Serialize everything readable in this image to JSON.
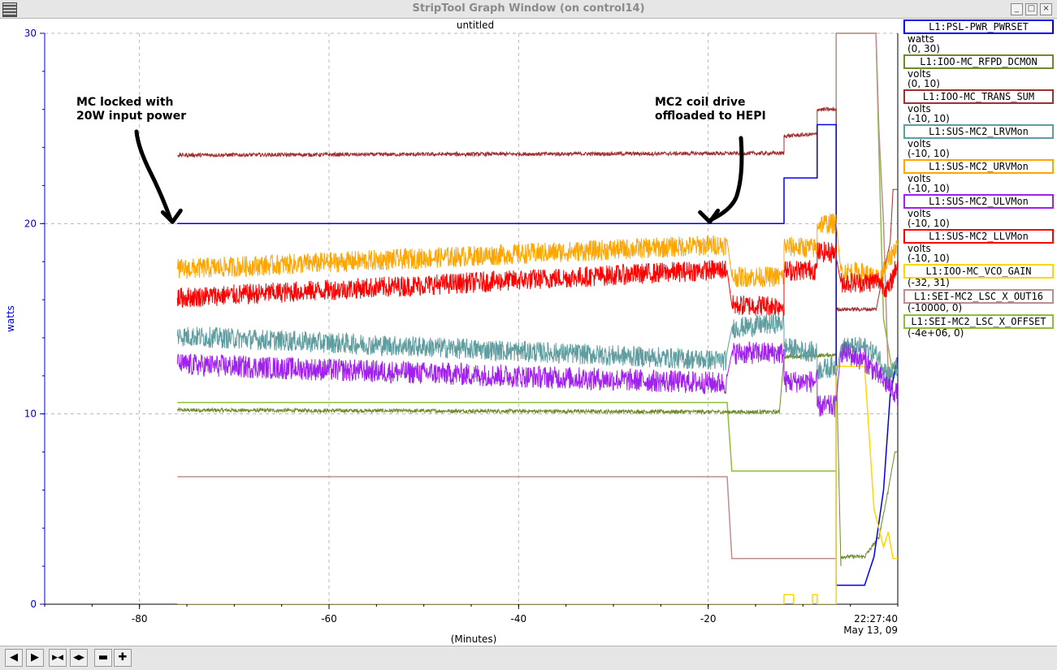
{
  "window": {
    "title": "StripTool Graph Window (on control14)",
    "menu_icon": "window-menu-icon",
    "min_icon": "minimize-icon",
    "max_icon": "maximize-icon",
    "close_icon": "close-icon"
  },
  "toolbar": {
    "buttons": [
      {
        "name": "scroll-left-icon",
        "glyph": "◀"
      },
      {
        "name": "scroll-right-icon",
        "glyph": "▶"
      },
      {
        "name": "zoom-in-time-icon",
        "glyph": "▶◀"
      },
      {
        "name": "zoom-out-time-icon",
        "glyph": "◀▶"
      },
      {
        "name": "pan-to-end-icon",
        "glyph": "▬"
      },
      {
        "name": "crosshair-icon",
        "glyph": "✚"
      }
    ]
  },
  "chart_data": {
    "type": "line",
    "title": "untitled",
    "ylabel": "watts",
    "xlabel": "(Minutes)",
    "xlim": [
      -90,
      0
    ],
    "ylim": [
      0,
      30
    ],
    "x_ticks": [
      -80,
      -60,
      -40,
      -20
    ],
    "y_ticks": [
      0,
      10,
      20,
      30
    ],
    "time_label": "22:27:40",
    "date_label": "May 13, 09",
    "grid": true,
    "legend_position": "right",
    "annotations": [
      {
        "text_line1": "MC locked with",
        "text_line2": "20W input power",
        "arrow_to": [
          -76,
          20
        ]
      },
      {
        "text_line1": "MC2 coil drive",
        "text_line2": "offloaded to HEPI",
        "arrow_to": [
          -20,
          20
        ]
      }
    ],
    "series": [
      {
        "name": "L1:PSL-PWR_PWRSET",
        "units": "watts",
        "range": "(0, 30)",
        "color": "#0000ee",
        "noise": 0,
        "points": [
          [
            -76,
            20
          ],
          [
            -12,
            20
          ],
          [
            -12,
            22.4
          ],
          [
            -8.5,
            22.4
          ],
          [
            -8.5,
            25.2
          ],
          [
            -6.5,
            25.2
          ],
          [
            -6.5,
            1.0
          ],
          [
            -3.5,
            1.0
          ],
          [
            -2.5,
            2.5
          ],
          [
            -1.5,
            6
          ],
          [
            -0.8,
            11
          ],
          [
            0,
            13
          ]
        ]
      },
      {
        "name": "L1:IOO-MC_RFPD_DCMON",
        "units": "volts",
        "range": "(0, 10)",
        "color": "#6e8b2a",
        "noise": 0.1,
        "points": [
          [
            -76,
            10.2
          ],
          [
            -12.5,
            10.1
          ],
          [
            -12,
            13
          ],
          [
            -6.5,
            13.1
          ],
          [
            -6,
            2
          ],
          [
            -6,
            2.5
          ],
          [
            -3.5,
            2.5
          ],
          [
            -2,
            3.5
          ],
          [
            -1,
            6
          ],
          [
            -0.3,
            8
          ],
          [
            0,
            8
          ]
        ]
      },
      {
        "name": "L1:IOO-MC_TRANS_SUM",
        "units": "volts",
        "range": "(-10, 10)",
        "color": "#a03030",
        "noise": 0.1,
        "points": [
          [
            -76,
            23.6
          ],
          [
            -12,
            23.7
          ],
          [
            -12,
            24.6
          ],
          [
            -8.5,
            24.7
          ],
          [
            -8.5,
            26.0
          ],
          [
            -6.5,
            26.0
          ],
          [
            -6.5,
            15.5
          ],
          [
            -2.3,
            15.5
          ],
          [
            -1.5,
            17.5
          ],
          [
            -0.8,
            19
          ],
          [
            -0.5,
            21.8
          ],
          [
            0,
            21.8
          ]
        ]
      },
      {
        "name": "L1:SUS-MC2_LRVMon",
        "units": "volts",
        "range": "(-10, 10)",
        "color": "#5f9ea0",
        "noise": 0.55,
        "points": [
          [
            -76,
            14.1
          ],
          [
            -18,
            12.8
          ],
          [
            -17.5,
            14.5
          ],
          [
            -12,
            14.8
          ],
          [
            -12,
            13.5
          ],
          [
            -8.5,
            13.2
          ],
          [
            -8.5,
            12.3
          ],
          [
            -6.5,
            12.5
          ],
          [
            -6,
            13.5
          ],
          [
            -3.5,
            13.5
          ],
          [
            -2,
            13
          ],
          [
            -1,
            12
          ],
          [
            0,
            12.5
          ]
        ]
      },
      {
        "name": "L1:SUS-MC2_URVMon",
        "units": "volts",
        "range": "(-10, 10)",
        "color": "#ffa500",
        "noise": 0.55,
        "points": [
          [
            -76,
            17.6
          ],
          [
            -18,
            18.9
          ],
          [
            -17.5,
            17.2
          ],
          [
            -12,
            17.2
          ],
          [
            -12,
            18.8
          ],
          [
            -8.5,
            18.7
          ],
          [
            -8.5,
            20.0
          ],
          [
            -6.5,
            20.0
          ],
          [
            -6,
            17.5
          ],
          [
            -3.5,
            17.4
          ],
          [
            -2,
            17
          ],
          [
            -1,
            18
          ],
          [
            0,
            19
          ]
        ]
      },
      {
        "name": "L1:SUS-MC2_ULVMon",
        "units": "volts",
        "range": "(-10, 10)",
        "color": "#a020f0",
        "noise": 0.6,
        "points": [
          [
            -76,
            12.6
          ],
          [
            -18,
            11.6
          ],
          [
            -17.5,
            13.2
          ],
          [
            -12,
            13.2
          ],
          [
            -12,
            11.7
          ],
          [
            -8.5,
            11.7
          ],
          [
            -8.5,
            10.4
          ],
          [
            -6.5,
            10.4
          ],
          [
            -6,
            13.3
          ],
          [
            -3.5,
            12.8
          ],
          [
            -2,
            12
          ],
          [
            -1,
            11.5
          ],
          [
            0,
            11
          ]
        ]
      },
      {
        "name": "L1:SUS-MC2_LLVMon",
        "units": "volts",
        "range": "(-10, 10)",
        "color": "#ff0000",
        "noise": 0.55,
        "points": [
          [
            -76,
            16.1
          ],
          [
            -18,
            17.6
          ],
          [
            -17.5,
            15.7
          ],
          [
            -12,
            15.7
          ],
          [
            -12,
            17.5
          ],
          [
            -8.5,
            17.6
          ],
          [
            -8.5,
            18.5
          ],
          [
            -6.5,
            18.5
          ],
          [
            -6,
            16.9
          ],
          [
            -3.5,
            16.9
          ],
          [
            -2,
            17
          ],
          [
            -1,
            16.5
          ],
          [
            0,
            18
          ]
        ]
      },
      {
        "name": "L1:IOO-MC_VCO_GAIN",
        "units": "",
        "range": "(-32, 31)",
        "color": "#ffd700",
        "noise": 0,
        "points": [
          [
            -76,
            0
          ],
          [
            -12,
            0
          ],
          [
            -12,
            0.5
          ],
          [
            -11,
            0.5
          ],
          [
            -11,
            0
          ],
          [
            -9,
            0
          ],
          [
            -9,
            0.5
          ],
          [
            -8.5,
            0.5
          ],
          [
            -8.5,
            0
          ],
          [
            -6.5,
            0
          ],
          [
            -6.5,
            12.5
          ],
          [
            -3.5,
            12.5
          ],
          [
            -2.5,
            5
          ],
          [
            -1.5,
            3
          ],
          [
            -1,
            3.8
          ],
          [
            -0.5,
            2.4
          ],
          [
            0,
            2.4
          ]
        ]
      },
      {
        "name": "L1:SEI-MC2_LSC_X_OUT16",
        "units": "",
        "range": "(-10000, 0)",
        "color": "#bc8f8f",
        "noise": 0,
        "points": [
          [
            -76,
            6.7
          ],
          [
            -18,
            6.7
          ],
          [
            -17.5,
            2.4
          ],
          [
            -6.5,
            2.4
          ],
          [
            -6.5,
            30
          ],
          [
            -2.3,
            30
          ],
          [
            -2,
            25
          ],
          [
            -1.5,
            20
          ],
          [
            -1,
            12
          ],
          [
            0,
            13
          ]
        ]
      },
      {
        "name": "L1:SEI-MC2_LSC_X_OFFSET",
        "units": "",
        "range": "(-4e+06, 0)",
        "color": "#8fbc3a",
        "noise": 0,
        "points": [
          [
            -76,
            10.6
          ],
          [
            -18,
            10.6
          ],
          [
            -17.5,
            7.0
          ],
          [
            -6.5,
            7.0
          ],
          [
            -6.5,
            30
          ],
          [
            -2.3,
            30
          ],
          [
            -2,
            24
          ],
          [
            -1.5,
            15
          ],
          [
            -0.5,
            12
          ],
          [
            0,
            13
          ]
        ]
      }
    ]
  }
}
